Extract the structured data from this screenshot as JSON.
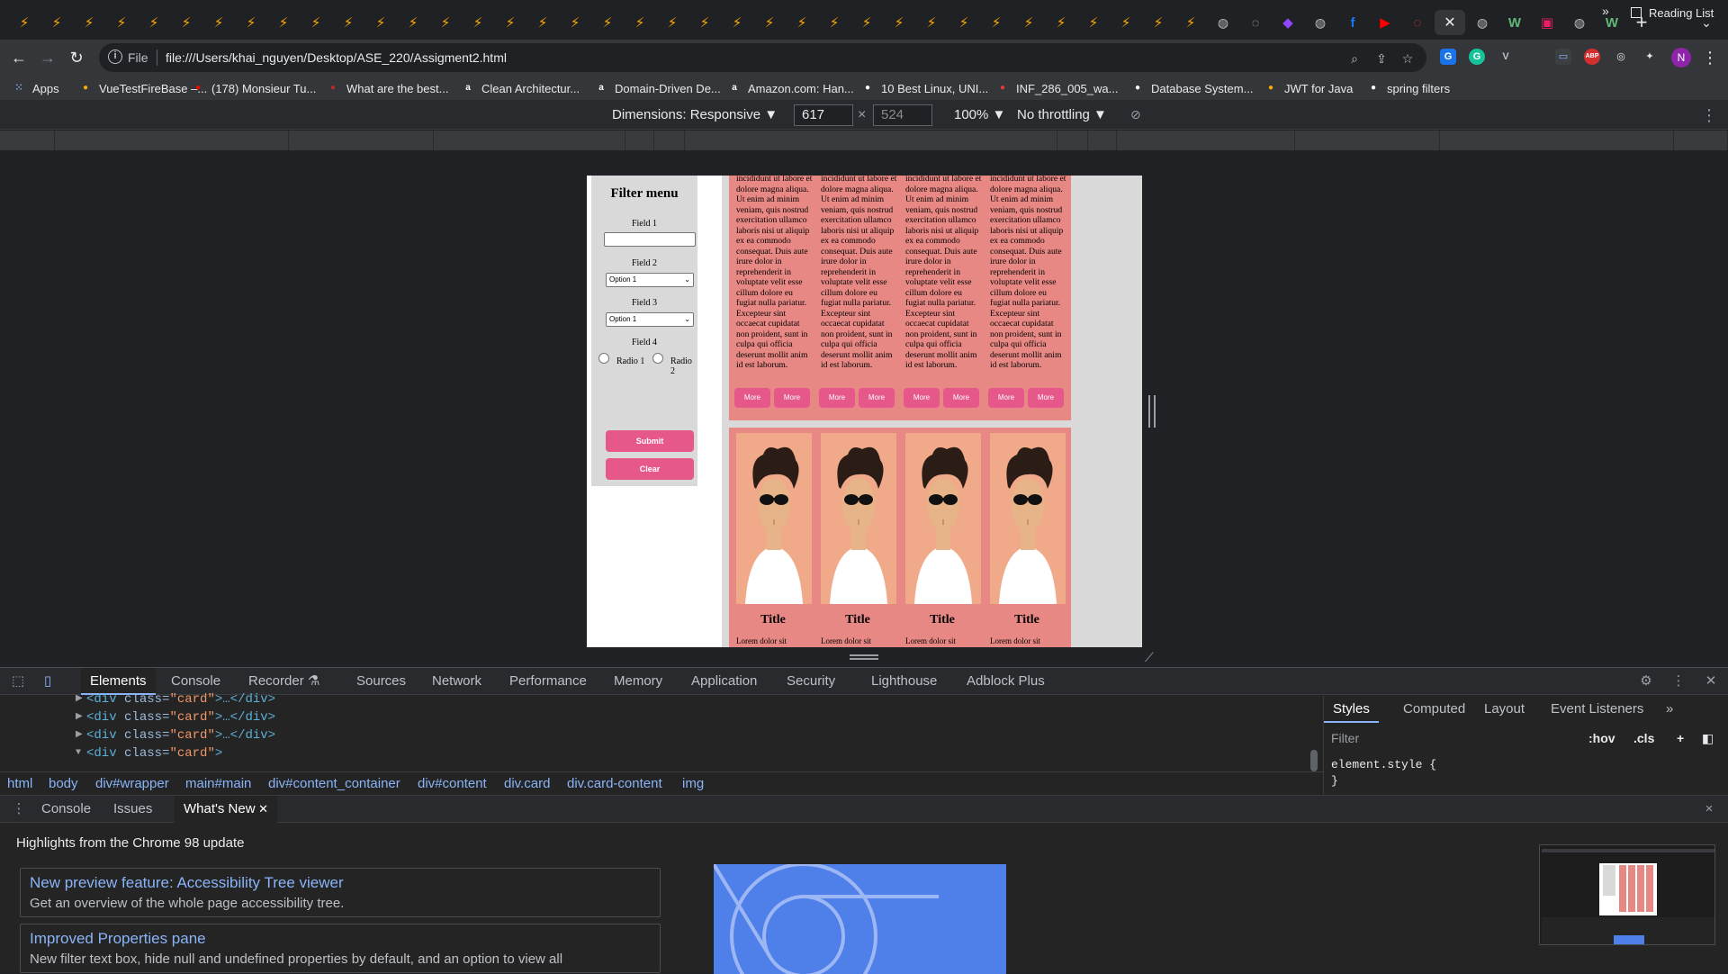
{
  "browser": {
    "tabs": [
      {
        "icon": "bolt-icon"
      },
      {
        "icon": "bolt-icon"
      },
      {
        "icon": "bolt-icon"
      },
      {
        "icon": "bolt-icon"
      },
      {
        "icon": "bolt-icon"
      },
      {
        "icon": "bolt-icon"
      },
      {
        "icon": "bolt-icon"
      },
      {
        "icon": "bolt-icon"
      },
      {
        "icon": "bolt-icon"
      },
      {
        "icon": "bolt-icon"
      },
      {
        "icon": "bolt-icon"
      },
      {
        "icon": "bolt-icon"
      },
      {
        "icon": "bolt-icon"
      },
      {
        "icon": "bolt-icon"
      },
      {
        "icon": "bolt-icon"
      },
      {
        "icon": "bolt-icon"
      },
      {
        "icon": "bolt-icon"
      },
      {
        "icon": "bolt-icon"
      },
      {
        "icon": "bolt-icon"
      },
      {
        "icon": "bolt-icon"
      },
      {
        "icon": "bolt-icon"
      },
      {
        "icon": "bolt-icon"
      },
      {
        "icon": "bolt-icon"
      },
      {
        "icon": "bolt-icon"
      },
      {
        "icon": "bolt-icon"
      },
      {
        "icon": "bolt-icon"
      },
      {
        "icon": "bolt-icon"
      },
      {
        "icon": "bolt-icon"
      },
      {
        "icon": "bolt-icon"
      },
      {
        "icon": "bolt-icon"
      },
      {
        "icon": "bolt-icon"
      },
      {
        "icon": "bolt-icon"
      },
      {
        "icon": "bolt-icon"
      },
      {
        "icon": "bolt-icon"
      },
      {
        "icon": "bolt-icon"
      },
      {
        "icon": "bolt-icon"
      },
      {
        "icon": "bolt-icon"
      },
      {
        "icon": "globe-icon"
      },
      {
        "icon": "blank-icon"
      },
      {
        "icon": "twitch-icon"
      },
      {
        "icon": "globe-icon"
      },
      {
        "icon": "facebook-icon"
      },
      {
        "icon": "youtube-icon"
      },
      {
        "icon": "loading-icon"
      },
      {
        "icon": "close-icon"
      },
      {
        "icon": "globe-icon"
      },
      {
        "icon": "w-icon"
      },
      {
        "icon": "pink-app-icon"
      },
      {
        "icon": "globe-icon"
      },
      {
        "icon": "w-icon"
      }
    ],
    "new_tab": "+",
    "address": {
      "scheme": "File",
      "url": "file:///Users/khai_nguyen/Desktop/ASE_220/Assigment2.html"
    },
    "profile_initial": "N",
    "bookmarks": [
      {
        "label": "Apps",
        "icon": "apps-grid-icon",
        "color": "#8ab4f8"
      },
      {
        "label": "VueTestFireBase –...",
        "icon": "firebase-icon",
        "color": "#f9ab00"
      },
      {
        "label": "(178) Monsieur Tu...",
        "icon": "youtube-icon",
        "color": "#ff0000"
      },
      {
        "label": "What are the best...",
        "icon": "quora-icon",
        "color": "#b92b27"
      },
      {
        "label": "Clean Architectur...",
        "icon": "amazon-icon",
        "color": "#ffffff"
      },
      {
        "label": "Domain-Driven De...",
        "icon": "amazon-icon",
        "color": "#ffffff"
      },
      {
        "label": "Amazon.com: Han...",
        "icon": "amazon-icon",
        "color": "#ffffff"
      },
      {
        "label": "10 Best Linux, UNI...",
        "icon": "linux-icon",
        "color": "#ffffff"
      },
      {
        "label": "INF_286_005_wa...",
        "icon": "loading-icon",
        "color": "#e53935"
      },
      {
        "label": "Database System...",
        "icon": "globe-icon",
        "color": "#ffffff"
      },
      {
        "label": "JWT for Java",
        "icon": "jwt-icon",
        "color": "#f9ab00"
      },
      {
        "label": "spring filters",
        "icon": "spring-icon",
        "color": "#ffffff"
      }
    ],
    "bookmarks_more": "»",
    "reading_list": "Reading List"
  },
  "device_toolbar": {
    "dimensions_label": "Dimensions: Responsive ▼",
    "width": "617",
    "height": "524",
    "times": "×",
    "zoom": "100% ▼",
    "throttling": "No throttling ▼"
  },
  "page": {
    "filter": {
      "title": "Filter menu",
      "field1_label": "Field 1",
      "field2_label": "Field 2",
      "field2_value": "Option 1",
      "field3_label": "Field 3",
      "field3_value": "Option 1",
      "field4_label": "Field 4",
      "radio1_label": "Radio 1",
      "radio2_label": "Radio 2",
      "submit_label": "Submit",
      "clear_label": "Clear"
    },
    "card_text": "incididunt ut labore et dolore magna aliqua. Ut enim ad minim veniam, quis nostrud exercitation ullamco laboris nisi ut aliquip ex ea commodo consequat. Duis aute irure dolor in reprehenderit in voluptate velit esse cillum dolore eu fugiat nulla pariatur. Excepteur sint occaecat cupidatat non proident, sunt in culpa qui officia deserunt mollit anim id est laborum.",
    "more_label": "More",
    "card_title": "Title",
    "card_sub": "Lorem dolor sit",
    "colors": {
      "card": "#e88884",
      "button": "#e6578a",
      "filter_bg": "#d9d9d9"
    }
  },
  "devtools": {
    "tabs": [
      "Elements",
      "Console",
      "Recorder ⚗",
      "Sources",
      "Network",
      "Performance",
      "Memory",
      "Application",
      "Security",
      "Lighthouse",
      "Adblock Plus"
    ],
    "dom_lines": [
      {
        "tag": "<div ",
        "attr": "class=",
        "val": "\"card\"",
        "rest": ">…</div>"
      },
      {
        "tag": "<div ",
        "attr": "class=",
        "val": "\"card\"",
        "rest": ">…</div>"
      },
      {
        "tag": "<div ",
        "attr": "class=",
        "val": "\"card\"",
        "rest": ">…</div>"
      },
      {
        "tag": "<div ",
        "attr": "class=",
        "val": "\"card\"",
        "rest": ">"
      }
    ],
    "breadcrumbs": [
      "html",
      "body",
      "div#wrapper",
      "main#main",
      "div#content_container",
      "div#content",
      "div.card",
      "div.card-content",
      "img"
    ],
    "styles_tabs": [
      "Styles",
      "Computed",
      "Layout",
      "Event Listeners",
      "»"
    ],
    "filter_placeholder": "Filter",
    "hov": ":hov",
    "cls": ".cls",
    "style_rule_open": "element.style {",
    "style_rule_close": "}",
    "drawer_tabs": [
      "Console",
      "Issues",
      "What's New"
    ],
    "drawer_close": "×",
    "highlights": "Highlights from the Chrome 98 update",
    "whats_new": [
      {
        "title": "New preview feature: Accessibility Tree viewer",
        "desc": "Get an overview of the whole page accessibility tree."
      },
      {
        "title": "Improved Properties pane",
        "desc": "New filter text box, hide null and undefined properties by default, and an option to view all"
      }
    ]
  }
}
